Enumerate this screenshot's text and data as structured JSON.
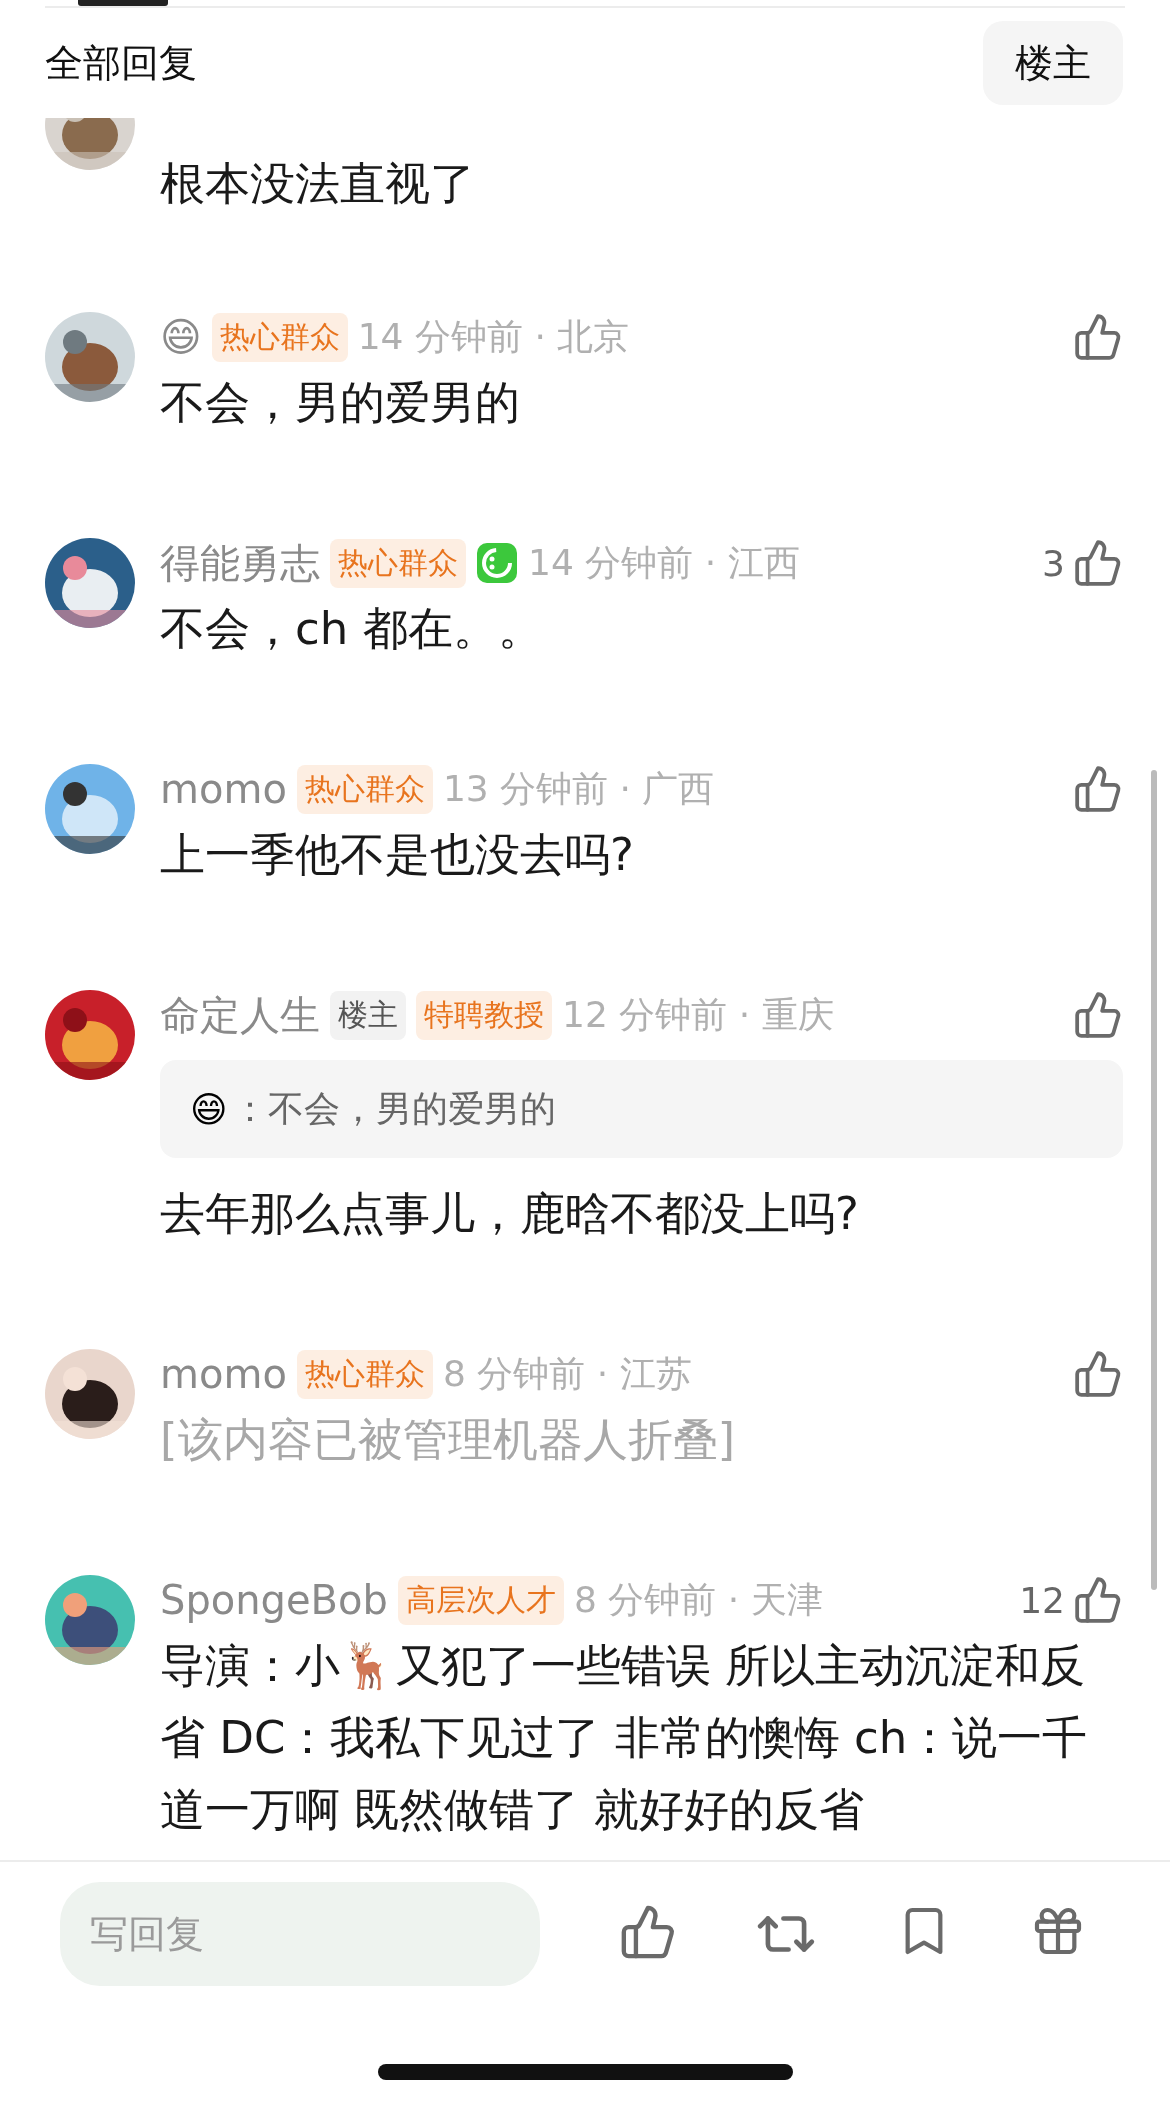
{
  "header": {
    "title": "全部回复",
    "filter_button": {
      "label": "楼主",
      "selected": false
    }
  },
  "partial_comment": {
    "body": "根本没法直视了"
  },
  "comments": [
    {
      "name": "😄",
      "badges": [
        {
          "label": "热心群众",
          "kind": "fan"
        }
      ],
      "when": "14 分钟前 · 北京",
      "folded": false,
      "body": "不会，男的爱男的"
    },
    {
      "name": "得能勇志",
      "badges": [
        {
          "label": "热心群众",
          "kind": "fan"
        }
      ],
      "app_icon": true,
      "when": "14 分钟前 · 江西",
      "likes": "3",
      "folded": false,
      "body": "不会，ch 都在。。"
    },
    {
      "name": "momo",
      "badges": [
        {
          "label": "热心群众",
          "kind": "fan"
        }
      ],
      "when": "13 分钟前 · 广西",
      "folded": false,
      "body": "上一季他不是也没去吗?"
    },
    {
      "name": "命定人生",
      "badges": [
        {
          "label": "楼主",
          "kind": "op"
        },
        {
          "label": "特聘教授",
          "kind": "fan"
        }
      ],
      "when": "12 分钟前 · 重庆",
      "folded": false,
      "quote": {
        "name": "😄",
        "text": "：不会，男的爱男的"
      },
      "body": "去年那么点事儿，鹿晗不都没上吗?"
    },
    {
      "name": "momo",
      "badges": [
        {
          "label": "热心群众",
          "kind": "fan"
        }
      ],
      "when": "8 分钟前 · 江苏",
      "folded": true,
      "body": "[该内容已被管理机器人折叠]"
    },
    {
      "name": "SpongeBob",
      "badges": [
        {
          "label": "高层次人才",
          "kind": "fan"
        }
      ],
      "when": "8 分钟前 · 天津",
      "likes": "12",
      "folded": false,
      "body": "导演：小🦌又犯了一些错误 所以主动沉淀和反省 DC：我私下见过了 非常的懊悔 ch：说一千道一万啊 既然做错了 就好好的反省"
    }
  ],
  "reply_bar": {
    "placeholder": "写回复"
  }
}
